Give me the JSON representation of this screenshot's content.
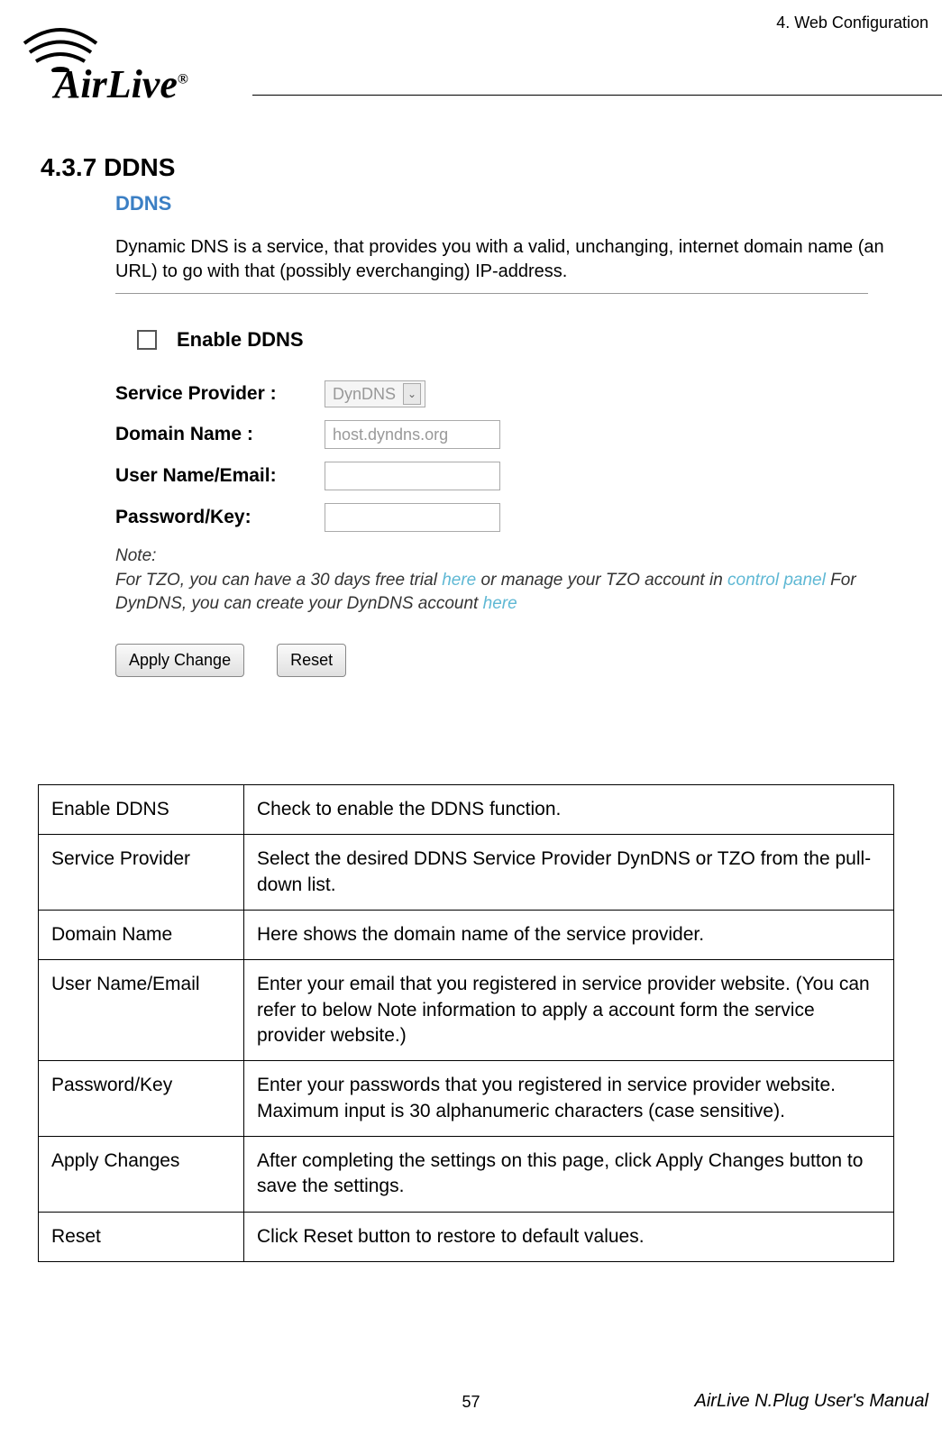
{
  "header": {
    "chapter": "4.  Web  Configuration"
  },
  "logo": {
    "brand": "AirLive",
    "reg": "®"
  },
  "section": {
    "number": "4.3.7",
    "title": "DDNS"
  },
  "panel": {
    "title": "DDNS",
    "description": "Dynamic DNS is a service, that provides you with a valid, unchanging, internet domain name (an URL) to go with that (possibly everchanging) IP-address.",
    "enable_label": "Enable DDNS",
    "fields": {
      "service_provider": {
        "label": "Service Provider :",
        "value": "DynDNS"
      },
      "domain_name": {
        "label": "Domain Name :",
        "value": "host.dyndns.org"
      },
      "user_name": {
        "label": "User Name/Email:",
        "value": ""
      },
      "password": {
        "label": "Password/Key:",
        "value": ""
      }
    },
    "note": {
      "prefix": "Note:",
      "line1_a": "For TZO, you can have a 30 days free trial ",
      "link1": "here",
      "line1_b": " or manage your TZO account in ",
      "link2": "control panel",
      "line2_a": " For DynDNS, you can create your DynDNS account ",
      "link3": "here"
    },
    "buttons": {
      "apply": "Apply Change",
      "reset": "Reset"
    }
  },
  "table": {
    "rows": [
      {
        "field": "Enable DDNS",
        "desc": "Check to enable the DDNS function."
      },
      {
        "field": "Service Provider",
        "desc": "Select the desired DDNS Service Provider DynDNS or TZO from the pull-down list."
      },
      {
        "field": "Domain Name",
        "desc": "Here shows the domain name of the service provider."
      },
      {
        "field": "User Name/Email",
        "desc": "Enter your email that you registered in service provider website. (You can refer to below Note information to apply a account form the service provider website.)"
      },
      {
        "field": "Password/Key",
        "desc": "Enter your passwords that you registered in service provider website. Maximum input is 30 alphanumeric characters (case sensitive)."
      },
      {
        "field": "Apply Changes",
        "desc": "After completing the settings on this page, click Apply Changes button to save the settings."
      },
      {
        "field": "Reset",
        "desc": "Click Reset button to restore to default values."
      }
    ]
  },
  "footer": {
    "page": "57",
    "manual": "AirLive N.Plug User's Manual"
  }
}
